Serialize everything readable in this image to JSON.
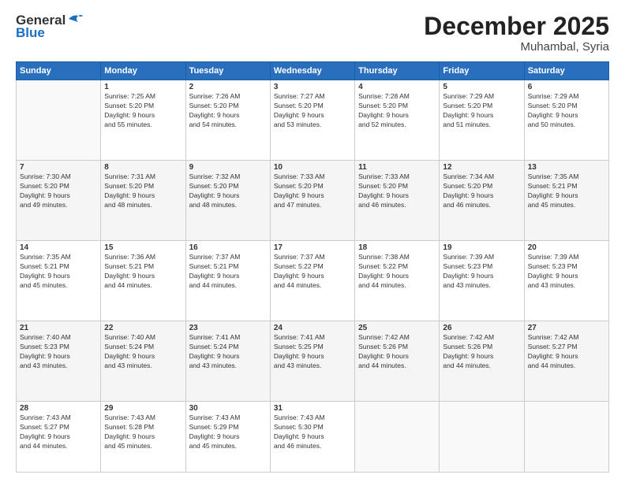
{
  "header": {
    "logo_general": "General",
    "logo_blue": "Blue",
    "month": "December 2025",
    "location": "Muhambal, Syria"
  },
  "days_of_week": [
    "Sunday",
    "Monday",
    "Tuesday",
    "Wednesday",
    "Thursday",
    "Friday",
    "Saturday"
  ],
  "weeks": [
    [
      {
        "day": "",
        "sunrise": "",
        "sunset": "",
        "daylight": ""
      },
      {
        "day": "1",
        "sunrise": "Sunrise: 7:25 AM",
        "sunset": "Sunset: 5:20 PM",
        "daylight": "Daylight: 9 hours and 55 minutes."
      },
      {
        "day": "2",
        "sunrise": "Sunrise: 7:26 AM",
        "sunset": "Sunset: 5:20 PM",
        "daylight": "Daylight: 9 hours and 54 minutes."
      },
      {
        "day": "3",
        "sunrise": "Sunrise: 7:27 AM",
        "sunset": "Sunset: 5:20 PM",
        "daylight": "Daylight: 9 hours and 53 minutes."
      },
      {
        "day": "4",
        "sunrise": "Sunrise: 7:28 AM",
        "sunset": "Sunset: 5:20 PM",
        "daylight": "Daylight: 9 hours and 52 minutes."
      },
      {
        "day": "5",
        "sunrise": "Sunrise: 7:29 AM",
        "sunset": "Sunset: 5:20 PM",
        "daylight": "Daylight: 9 hours and 51 minutes."
      },
      {
        "day": "6",
        "sunrise": "Sunrise: 7:29 AM",
        "sunset": "Sunset: 5:20 PM",
        "daylight": "Daylight: 9 hours and 50 minutes."
      }
    ],
    [
      {
        "day": "7",
        "sunrise": "Sunrise: 7:30 AM",
        "sunset": "Sunset: 5:20 PM",
        "daylight": "Daylight: 9 hours and 49 minutes."
      },
      {
        "day": "8",
        "sunrise": "Sunrise: 7:31 AM",
        "sunset": "Sunset: 5:20 PM",
        "daylight": "Daylight: 9 hours and 48 minutes."
      },
      {
        "day": "9",
        "sunrise": "Sunrise: 7:32 AM",
        "sunset": "Sunset: 5:20 PM",
        "daylight": "Daylight: 9 hours and 48 minutes."
      },
      {
        "day": "10",
        "sunrise": "Sunrise: 7:33 AM",
        "sunset": "Sunset: 5:20 PM",
        "daylight": "Daylight: 9 hours and 47 minutes."
      },
      {
        "day": "11",
        "sunrise": "Sunrise: 7:33 AM",
        "sunset": "Sunset: 5:20 PM",
        "daylight": "Daylight: 9 hours and 46 minutes."
      },
      {
        "day": "12",
        "sunrise": "Sunrise: 7:34 AM",
        "sunset": "Sunset: 5:20 PM",
        "daylight": "Daylight: 9 hours and 46 minutes."
      },
      {
        "day": "13",
        "sunrise": "Sunrise: 7:35 AM",
        "sunset": "Sunset: 5:21 PM",
        "daylight": "Daylight: 9 hours and 45 minutes."
      }
    ],
    [
      {
        "day": "14",
        "sunrise": "Sunrise: 7:35 AM",
        "sunset": "Sunset: 5:21 PM",
        "daylight": "Daylight: 9 hours and 45 minutes."
      },
      {
        "day": "15",
        "sunrise": "Sunrise: 7:36 AM",
        "sunset": "Sunset: 5:21 PM",
        "daylight": "Daylight: 9 hours and 44 minutes."
      },
      {
        "day": "16",
        "sunrise": "Sunrise: 7:37 AM",
        "sunset": "Sunset: 5:21 PM",
        "daylight": "Daylight: 9 hours and 44 minutes."
      },
      {
        "day": "17",
        "sunrise": "Sunrise: 7:37 AM",
        "sunset": "Sunset: 5:22 PM",
        "daylight": "Daylight: 9 hours and 44 minutes."
      },
      {
        "day": "18",
        "sunrise": "Sunrise: 7:38 AM",
        "sunset": "Sunset: 5:22 PM",
        "daylight": "Daylight: 9 hours and 44 minutes."
      },
      {
        "day": "19",
        "sunrise": "Sunrise: 7:39 AM",
        "sunset": "Sunset: 5:23 PM",
        "daylight": "Daylight: 9 hours and 43 minutes."
      },
      {
        "day": "20",
        "sunrise": "Sunrise: 7:39 AM",
        "sunset": "Sunset: 5:23 PM",
        "daylight": "Daylight: 9 hours and 43 minutes."
      }
    ],
    [
      {
        "day": "21",
        "sunrise": "Sunrise: 7:40 AM",
        "sunset": "Sunset: 5:23 PM",
        "daylight": "Daylight: 9 hours and 43 minutes."
      },
      {
        "day": "22",
        "sunrise": "Sunrise: 7:40 AM",
        "sunset": "Sunset: 5:24 PM",
        "daylight": "Daylight: 9 hours and 43 minutes."
      },
      {
        "day": "23",
        "sunrise": "Sunrise: 7:41 AM",
        "sunset": "Sunset: 5:24 PM",
        "daylight": "Daylight: 9 hours and 43 minutes."
      },
      {
        "day": "24",
        "sunrise": "Sunrise: 7:41 AM",
        "sunset": "Sunset: 5:25 PM",
        "daylight": "Daylight: 9 hours and 43 minutes."
      },
      {
        "day": "25",
        "sunrise": "Sunrise: 7:42 AM",
        "sunset": "Sunset: 5:26 PM",
        "daylight": "Daylight: 9 hours and 44 minutes."
      },
      {
        "day": "26",
        "sunrise": "Sunrise: 7:42 AM",
        "sunset": "Sunset: 5:26 PM",
        "daylight": "Daylight: 9 hours and 44 minutes."
      },
      {
        "day": "27",
        "sunrise": "Sunrise: 7:42 AM",
        "sunset": "Sunset: 5:27 PM",
        "daylight": "Daylight: 9 hours and 44 minutes."
      }
    ],
    [
      {
        "day": "28",
        "sunrise": "Sunrise: 7:43 AM",
        "sunset": "Sunset: 5:27 PM",
        "daylight": "Daylight: 9 hours and 44 minutes."
      },
      {
        "day": "29",
        "sunrise": "Sunrise: 7:43 AM",
        "sunset": "Sunset: 5:28 PM",
        "daylight": "Daylight: 9 hours and 45 minutes."
      },
      {
        "day": "30",
        "sunrise": "Sunrise: 7:43 AM",
        "sunset": "Sunset: 5:29 PM",
        "daylight": "Daylight: 9 hours and 45 minutes."
      },
      {
        "day": "31",
        "sunrise": "Sunrise: 7:43 AM",
        "sunset": "Sunset: 5:30 PM",
        "daylight": "Daylight: 9 hours and 46 minutes."
      },
      {
        "day": "",
        "sunrise": "",
        "sunset": "",
        "daylight": ""
      },
      {
        "day": "",
        "sunrise": "",
        "sunset": "",
        "daylight": ""
      },
      {
        "day": "",
        "sunrise": "",
        "sunset": "",
        "daylight": ""
      }
    ]
  ]
}
